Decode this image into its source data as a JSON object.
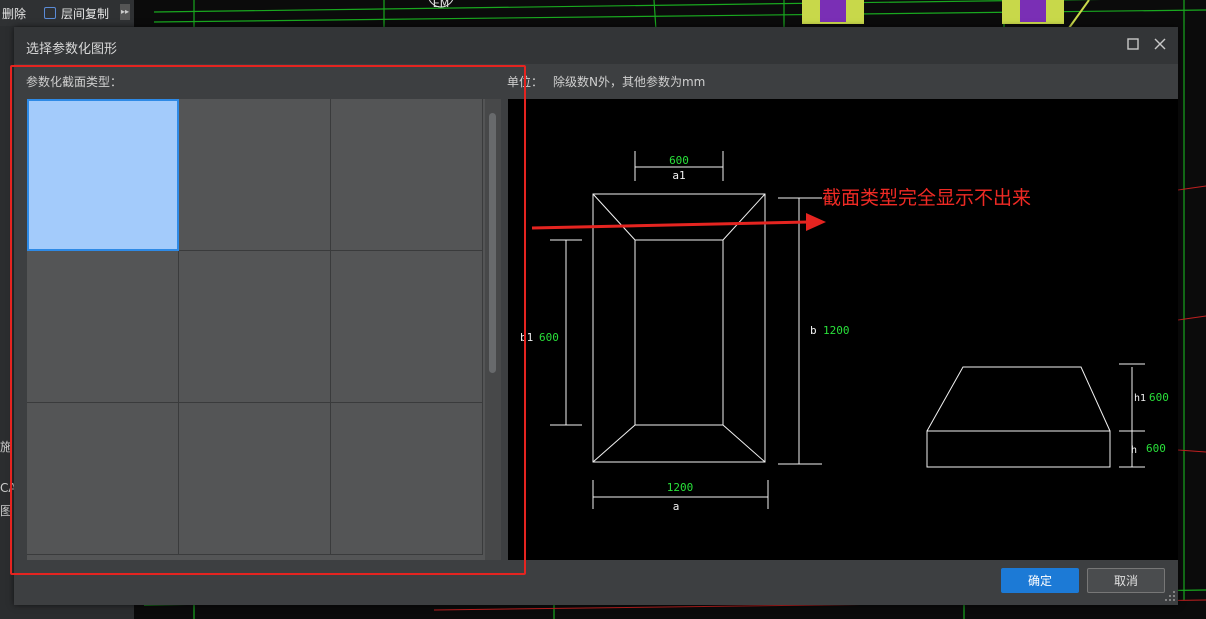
{
  "background_app": {
    "toolbar": {
      "delete_label": "删除",
      "floor_copy_label": "层间复制"
    },
    "left_fragments": [
      "施",
      "CA",
      "图"
    ],
    "cad_marker": "EM"
  },
  "dialog": {
    "title": "选择参数化图形",
    "section_type_label": "参数化截面类型：",
    "unit_label": "单位：",
    "unit_note": "除级数N外，其他参数为mm",
    "thumbnails": [
      {
        "selected": true
      },
      {
        "selected": false
      },
      {
        "selected": false
      },
      {
        "selected": false
      },
      {
        "selected": false
      },
      {
        "selected": false
      },
      {
        "selected": false
      },
      {
        "selected": false
      },
      {
        "selected": false
      }
    ],
    "ok_label": "确定",
    "cancel_label": "取消"
  },
  "preview_drawing": {
    "a1_value": "600",
    "a1_label": "a1",
    "b1_label": "b1",
    "b1_value": "600",
    "b_label": "b",
    "b_value": "1200",
    "a_value": "1200",
    "a_label": "a",
    "h1_label": "h1",
    "h1_value": "600",
    "h_label": "h",
    "h_value": "600"
  },
  "annotation": {
    "text": "截面类型完全显示不出来"
  },
  "colors": {
    "accent": "#1c7ad6",
    "annotation_red": "#e52420",
    "dimension_green": "#29e03a",
    "selected_thumb": "#a3cbfb"
  }
}
